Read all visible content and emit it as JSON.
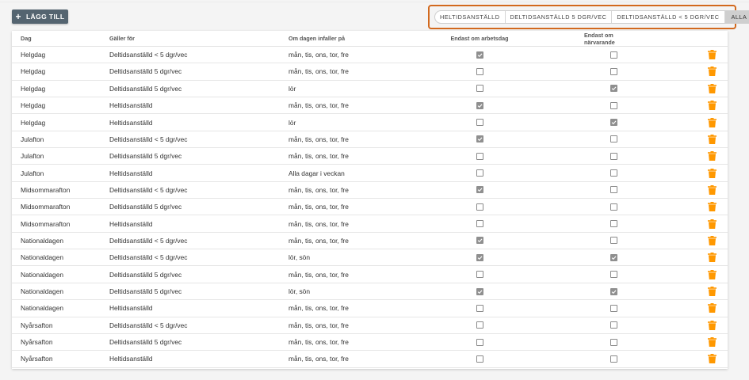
{
  "toolbar": {
    "add_label": "LÄGG TILL"
  },
  "filters": [
    {
      "label": "HELTIDSANSTÄLLD",
      "active": false
    },
    {
      "label": "DELTIDSANSTÄLLD 5 DGR/VEC",
      "active": false
    },
    {
      "label": "DELTIDSANSTÄLLD < 5 DGR/VEC",
      "active": false
    },
    {
      "label": "ALLA",
      "active": true
    }
  ],
  "table": {
    "headers": {
      "dag": "Dag",
      "galler_for": "Gäller för",
      "om_dagen": "Om dagen infaller på",
      "endast_arbetsdag": "Endast om arbetsdag",
      "endast_narvarande": "Endast om närvarande"
    },
    "rows": [
      {
        "dag": "Helgdag",
        "galler_for": "Deltidsanställd < 5 dgr/vec",
        "om_dagen": "mån, tis, ons, tor, fre",
        "arbetsdag": true,
        "narvarande": false
      },
      {
        "dag": "Helgdag",
        "galler_for": "Deltidsanställd 5 dgr/vec",
        "om_dagen": "mån, tis, ons, tor, fre",
        "arbetsdag": false,
        "narvarande": false
      },
      {
        "dag": "Helgdag",
        "galler_for": "Deltidsanställd 5 dgr/vec",
        "om_dagen": "lör",
        "arbetsdag": false,
        "narvarande": true
      },
      {
        "dag": "Helgdag",
        "galler_for": "Heltidsanställd",
        "om_dagen": "mån, tis, ons, tor, fre",
        "arbetsdag": true,
        "narvarande": false
      },
      {
        "dag": "Helgdag",
        "galler_for": "Heltidsanställd",
        "om_dagen": "lör",
        "arbetsdag": false,
        "narvarande": true
      },
      {
        "dag": "Julafton",
        "galler_for": "Deltidsanställd < 5 dgr/vec",
        "om_dagen": "mån, tis, ons, tor, fre",
        "arbetsdag": true,
        "narvarande": false
      },
      {
        "dag": "Julafton",
        "galler_for": "Deltidsanställd 5 dgr/vec",
        "om_dagen": "mån, tis, ons, tor, fre",
        "arbetsdag": false,
        "narvarande": false
      },
      {
        "dag": "Julafton",
        "galler_for": "Heltidsanställd",
        "om_dagen": "Alla dagar i veckan",
        "arbetsdag": false,
        "narvarande": false
      },
      {
        "dag": "Midsommarafton",
        "galler_for": "Deltidsanställd < 5 dgr/vec",
        "om_dagen": "mån, tis, ons, tor, fre",
        "arbetsdag": true,
        "narvarande": false
      },
      {
        "dag": "Midsommarafton",
        "galler_for": "Deltidsanställd 5 dgr/vec",
        "om_dagen": "mån, tis, ons, tor, fre",
        "arbetsdag": false,
        "narvarande": false
      },
      {
        "dag": "Midsommarafton",
        "galler_for": "Heltidsanställd",
        "om_dagen": "mån, tis, ons, tor, fre",
        "arbetsdag": false,
        "narvarande": false
      },
      {
        "dag": "Nationaldagen",
        "galler_for": "Deltidsanställd < 5 dgr/vec",
        "om_dagen": "mån, tis, ons, tor, fre",
        "arbetsdag": true,
        "narvarande": false
      },
      {
        "dag": "Nationaldagen",
        "galler_for": "Deltidsanställd < 5 dgr/vec",
        "om_dagen": "lör, sön",
        "arbetsdag": true,
        "narvarande": true
      },
      {
        "dag": "Nationaldagen",
        "galler_for": "Deltidsanställd 5 dgr/vec",
        "om_dagen": "mån, tis, ons, tor, fre",
        "arbetsdag": false,
        "narvarande": false
      },
      {
        "dag": "Nationaldagen",
        "galler_for": "Deltidsanställd 5 dgr/vec",
        "om_dagen": "lör, sön",
        "arbetsdag": true,
        "narvarande": true
      },
      {
        "dag": "Nationaldagen",
        "galler_for": "Heltidsanställd",
        "om_dagen": "mån, tis, ons, tor, fre",
        "arbetsdag": false,
        "narvarande": false
      },
      {
        "dag": "Nyårsafton",
        "galler_for": "Deltidsanställd < 5 dgr/vec",
        "om_dagen": "mån, tis, ons, tor, fre",
        "arbetsdag": false,
        "narvarande": false
      },
      {
        "dag": "Nyårsafton",
        "galler_for": "Deltidsanställd 5 dgr/vec",
        "om_dagen": "mån, tis, ons, tor, fre",
        "arbetsdag": false,
        "narvarande": false
      },
      {
        "dag": "Nyårsafton",
        "galler_for": "Heltidsanställd",
        "om_dagen": "mån, tis, ons, tor, fre",
        "arbetsdag": false,
        "narvarande": false
      }
    ]
  },
  "colors": {
    "add_button": "#546470",
    "highlight_border": "#d2691e",
    "delete_icon": "#ff9800",
    "checkbox_checked": "#8f8f8f"
  },
  "icons": {
    "add": "plus-icon",
    "delete": "trash-icon",
    "checked": "check-icon"
  }
}
